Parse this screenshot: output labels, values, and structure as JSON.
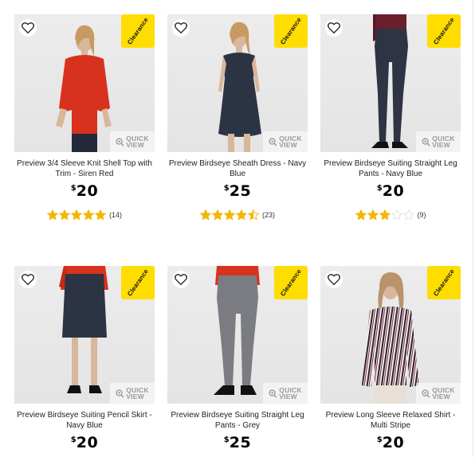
{
  "colors": {
    "badge": "#ffdd00",
    "star": "#f2b705",
    "star_empty": "#e2e2e2",
    "heart_stroke": "#222222"
  },
  "badge_label": "Clearance",
  "quick_view": {
    "line1": "QUICK",
    "line2": "VIEW"
  },
  "products": [
    {
      "name": "Preview 3/4 Sleeve Knit Shell Top with Trim - Siren Red",
      "price_currency": "$",
      "price": "20",
      "rating": 5,
      "review_count": "(14)",
      "garment": "red-top"
    },
    {
      "name": "Preview Birdseye Sheath Dress - Navy Blue",
      "price_currency": "$",
      "price": "25",
      "rating": 4.5,
      "review_count": "(23)",
      "garment": "navy-dress"
    },
    {
      "name": "Preview Birdseye Suiting Straight Leg Pants - Navy Blue",
      "price_currency": "$",
      "price": "20",
      "rating": 3,
      "review_count": "(9)",
      "garment": "navy-pants"
    },
    {
      "name": "Preview Birdseye Suiting Pencil Skirt - Navy Blue",
      "price_currency": "$",
      "price": "20",
      "garment": "navy-skirt"
    },
    {
      "name": "Preview Birdseye Suiting Straight Leg Pants - Grey",
      "price_currency": "$",
      "price": "25",
      "garment": "grey-pants"
    },
    {
      "name": "Preview Long Sleeve Relaxed Shirt - Multi Stripe",
      "price_currency": "$",
      "price": "20",
      "garment": "stripe-shirt"
    }
  ]
}
